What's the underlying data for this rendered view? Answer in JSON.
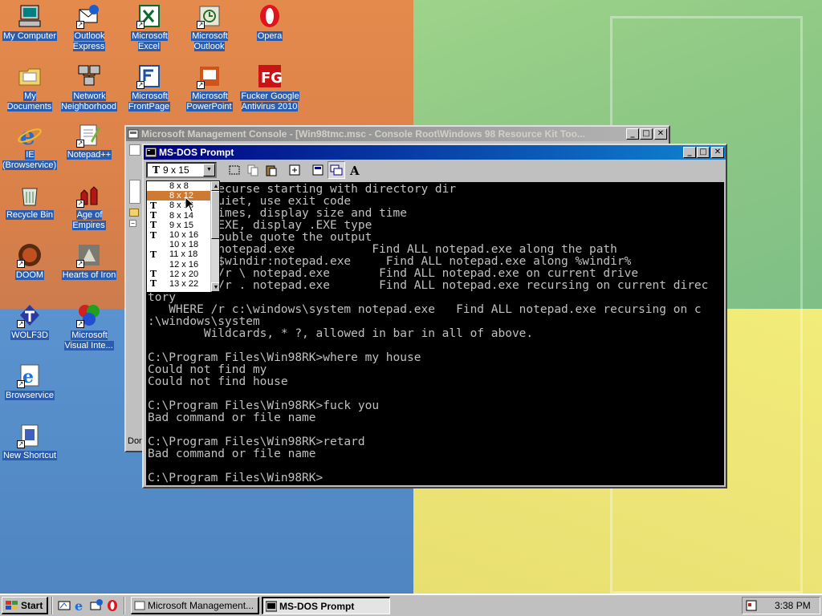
{
  "desktop": {
    "icons": [
      {
        "label": "My Computer",
        "icon": "computer-icon"
      },
      {
        "label": "Outlook Express",
        "icon": "outlook-express-icon"
      },
      {
        "label": "Microsoft Excel",
        "icon": "excel-icon"
      },
      {
        "label": "Microsoft Outlook",
        "icon": "outlook-icon"
      },
      {
        "label": "Opera",
        "icon": "opera-icon"
      },
      {
        "label": "My Documents",
        "icon": "folder-icon"
      },
      {
        "label": "Network Neighborhood",
        "icon": "network-icon"
      },
      {
        "label": "Microsoft FrontPage",
        "icon": "frontpage-icon"
      },
      {
        "label": "Microsoft PowerPoint",
        "icon": "powerpoint-icon"
      },
      {
        "label": "Fucker Google Antivirus 2010",
        "icon": "antivirus-icon"
      },
      {
        "label": "IE (Browservice)",
        "icon": "ie-icon"
      },
      {
        "label": "Notepad++",
        "icon": "notepad-icon"
      },
      {
        "label": "Recycle Bin",
        "icon": "recycle-bin-icon"
      },
      {
        "label": "Age of Empires",
        "icon": "age-of-empires-icon"
      },
      {
        "label": "DOOM",
        "icon": "doom-icon"
      },
      {
        "label": "Hearts of Iron",
        "icon": "hearts-of-iron-icon"
      },
      {
        "label": "WOLF3D",
        "icon": "wolf3d-icon"
      },
      {
        "label": "Microsoft Visual Inte...",
        "icon": "visual-interdev-icon"
      },
      {
        "label": "Browservice",
        "icon": "browservice-icon"
      },
      {
        "label": "New Shortcut",
        "icon": "shortcut-icon"
      }
    ]
  },
  "mmc_window": {
    "title": "Microsoft Management Console - [Win98tmc.msc - Console Root\\Windows 98 Resource Kit Too...",
    "status_fragment": "Dor"
  },
  "dos_window": {
    "title": "MS-DOS Prompt",
    "font_selector": {
      "value": "9 x 15"
    },
    "font_sizes": [
      {
        "label": "8 x 8",
        "truetype": false
      },
      {
        "label": "8 x 12",
        "truetype": false,
        "selected": true
      },
      {
        "label": "8 x 13",
        "truetype": true
      },
      {
        "label": "8 x 14",
        "truetype": true
      },
      {
        "label": "9 x 15",
        "truetype": true
      },
      {
        "label": "10 x 16",
        "truetype": true
      },
      {
        "label": "10 x 18",
        "truetype": false
      },
      {
        "label": "11 x 18",
        "truetype": true
      },
      {
        "label": "12 x 16",
        "truetype": false
      },
      {
        "label": "12 x 20",
        "truetype": true
      },
      {
        "label": "13 x 22",
        "truetype": true
      }
    ],
    "console_lines": [
      "          ecurse starting with directory dir",
      "          uiet, use exit code",
      "          imes, display size and time",
      "          EXE, display .EXE type",
      "          ouble quote the output",
      "          notepad.exe           Find ALL notepad.exe along the path",
      "          $windir:notepad.exe     Find ALL notepad.exe along %windir%",
      "          /r \\ notepad.exe       Find ALL notepad.exe on current drive",
      "          /r . notepad.exe       Find ALL notepad.exe recursing on current direc",
      "tory",
      "   WHERE /r c:\\windows\\system notepad.exe   Find ALL notepad.exe recursing on c",
      ":\\windows\\system",
      "        Wildcards, * ?, allowed in bar in all of above.",
      "",
      "C:\\Program Files\\Win98RK>where my house",
      "Could not find my",
      "Could not find house",
      "",
      "C:\\Program Files\\Win98RK>fuck you",
      "Bad command or file name",
      "",
      "C:\\Program Files\\Win98RK>retard",
      "Bad command or file name",
      "",
      "C:\\Program Files\\Win98RK>"
    ]
  },
  "taskbar": {
    "start_label": "Start",
    "quick_launch": [
      "desktop-icon",
      "ie-icon",
      "outlook-express-icon",
      "opera-icon"
    ],
    "tasks": [
      {
        "label": "Microsoft Management...",
        "active": false
      },
      {
        "label": "MS-DOS Prompt",
        "active": true
      }
    ],
    "clock": "3:38 PM"
  }
}
